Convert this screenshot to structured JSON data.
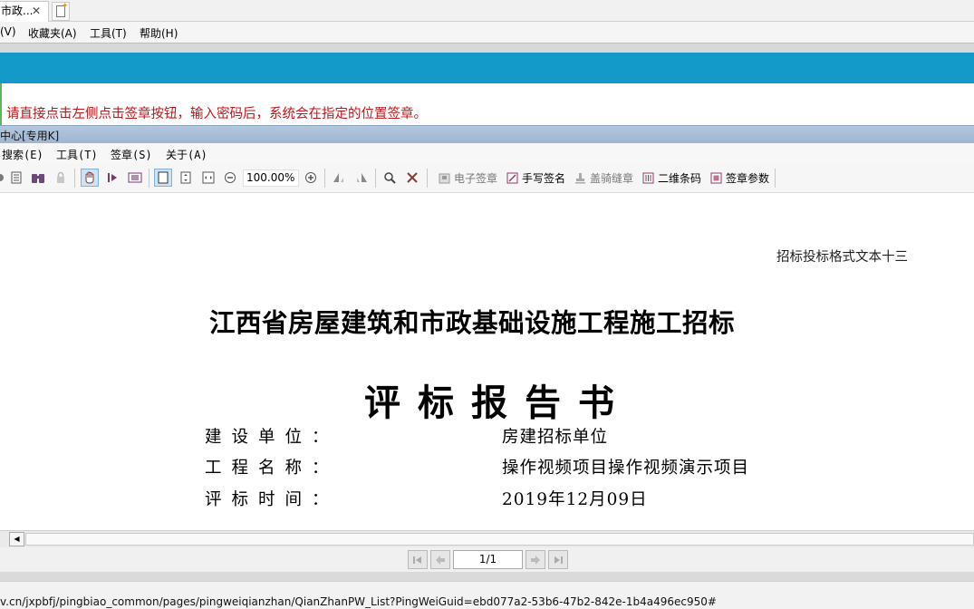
{
  "browser": {
    "tab_title": "市政...",
    "tab_close": "✕",
    "menu": [
      "(V)",
      "收藏夹(A)",
      "工具(T)",
      "帮助(H)"
    ]
  },
  "notice": "请直接点击左侧点击签章按钮，输入密码后，系统会在指定的位置签章。",
  "plugin": {
    "title": "中心[专用K]",
    "menu": [
      "搜索(E)",
      "工具(T)",
      "签章(S)",
      "关于(A)"
    ],
    "zoom": "100.00%",
    "sign_tools": [
      "电子签章",
      "手写签名",
      "盖骑缝章",
      "二维条码",
      "签章参数"
    ]
  },
  "document": {
    "header_note": "招标投标格式文本十三",
    "title_line1": "江西省房屋建筑和市政基础设施工程施工招标",
    "title_line2": "评标报告书",
    "fields": [
      {
        "label": "建设单位：",
        "value": "房建招标单位"
      },
      {
        "label": "工程名称：",
        "value": "操作视频项目操作视频演示项目"
      },
      {
        "label": "评标时间：",
        "value": "2019年12月09日"
      }
    ]
  },
  "pager": {
    "page": "1/1"
  },
  "status_url": "v.cn/jxpbfj/pingbiao_common/pages/pingweiqianzhan/QianZhanPW_List?PingWeiGuid=ebd077a2-53b6-47b2-842e-1b4a496ec950#"
}
